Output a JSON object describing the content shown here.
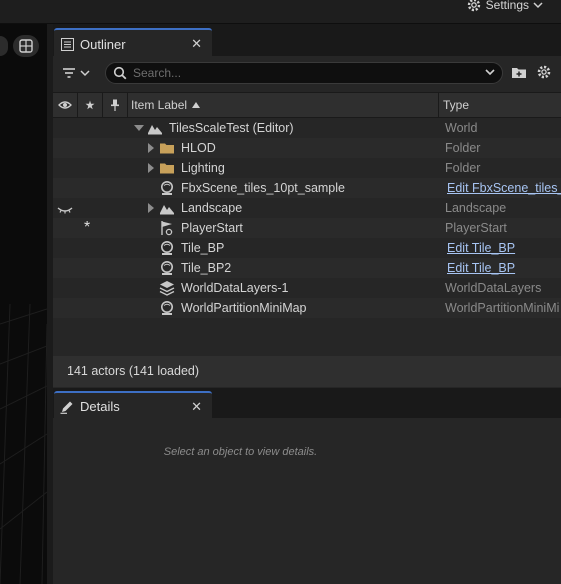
{
  "topbar": {
    "settings_label": "Settings",
    "settings_icon": "gear-icon"
  },
  "outliner": {
    "tab_label": "Outliner",
    "tab_close": "✕",
    "search_placeholder": "Search...",
    "columns": {
      "item_label": "Item Label",
      "type": "Type"
    },
    "rows": [
      {
        "label": "TilesScaleTest (Editor)",
        "type": "World",
        "icon": "world-icon",
        "expander": "expanded"
      },
      {
        "label": "HLOD",
        "type": "Folder",
        "icon": "folder-icon",
        "expander": "collapsed"
      },
      {
        "label": "Lighting",
        "type": "Folder",
        "icon": "folder-icon",
        "expander": "collapsed"
      },
      {
        "label": "FbxScene_tiles_10pt_sample",
        "type": "Edit FbxScene_tiles_",
        "type_is_link": true,
        "icon": "actor-icon"
      },
      {
        "label": "Landscape",
        "type": "Landscape",
        "icon": "landscape-icon",
        "expander": "collapsed",
        "visibility_state": "hidden"
      },
      {
        "label": "PlayerStart",
        "type": "PlayerStart",
        "icon": "player-start-icon",
        "pinned_marker": "*"
      },
      {
        "label": "Tile_BP",
        "type": "Edit Tile_BP",
        "type_is_link": true,
        "icon": "actor-icon"
      },
      {
        "label": "Tile_BP2",
        "type": "Edit Tile_BP",
        "type_is_link": true,
        "icon": "actor-icon"
      },
      {
        "label": "WorldDataLayers-1",
        "type": "WorldDataLayers",
        "icon": "data-layers-icon"
      },
      {
        "label": "WorldPartitionMiniMap",
        "type": "WorldPartitionMiniMi",
        "icon": "actor-icon"
      }
    ],
    "status": "141 actors (141 loaded)"
  },
  "details": {
    "tab_label": "Details",
    "tab_close": "✕",
    "hint": "Select an object to view details."
  },
  "colors": {
    "accent": "#3d6fc4",
    "link": "#a7c4f2",
    "folder": "#c8a15a"
  }
}
